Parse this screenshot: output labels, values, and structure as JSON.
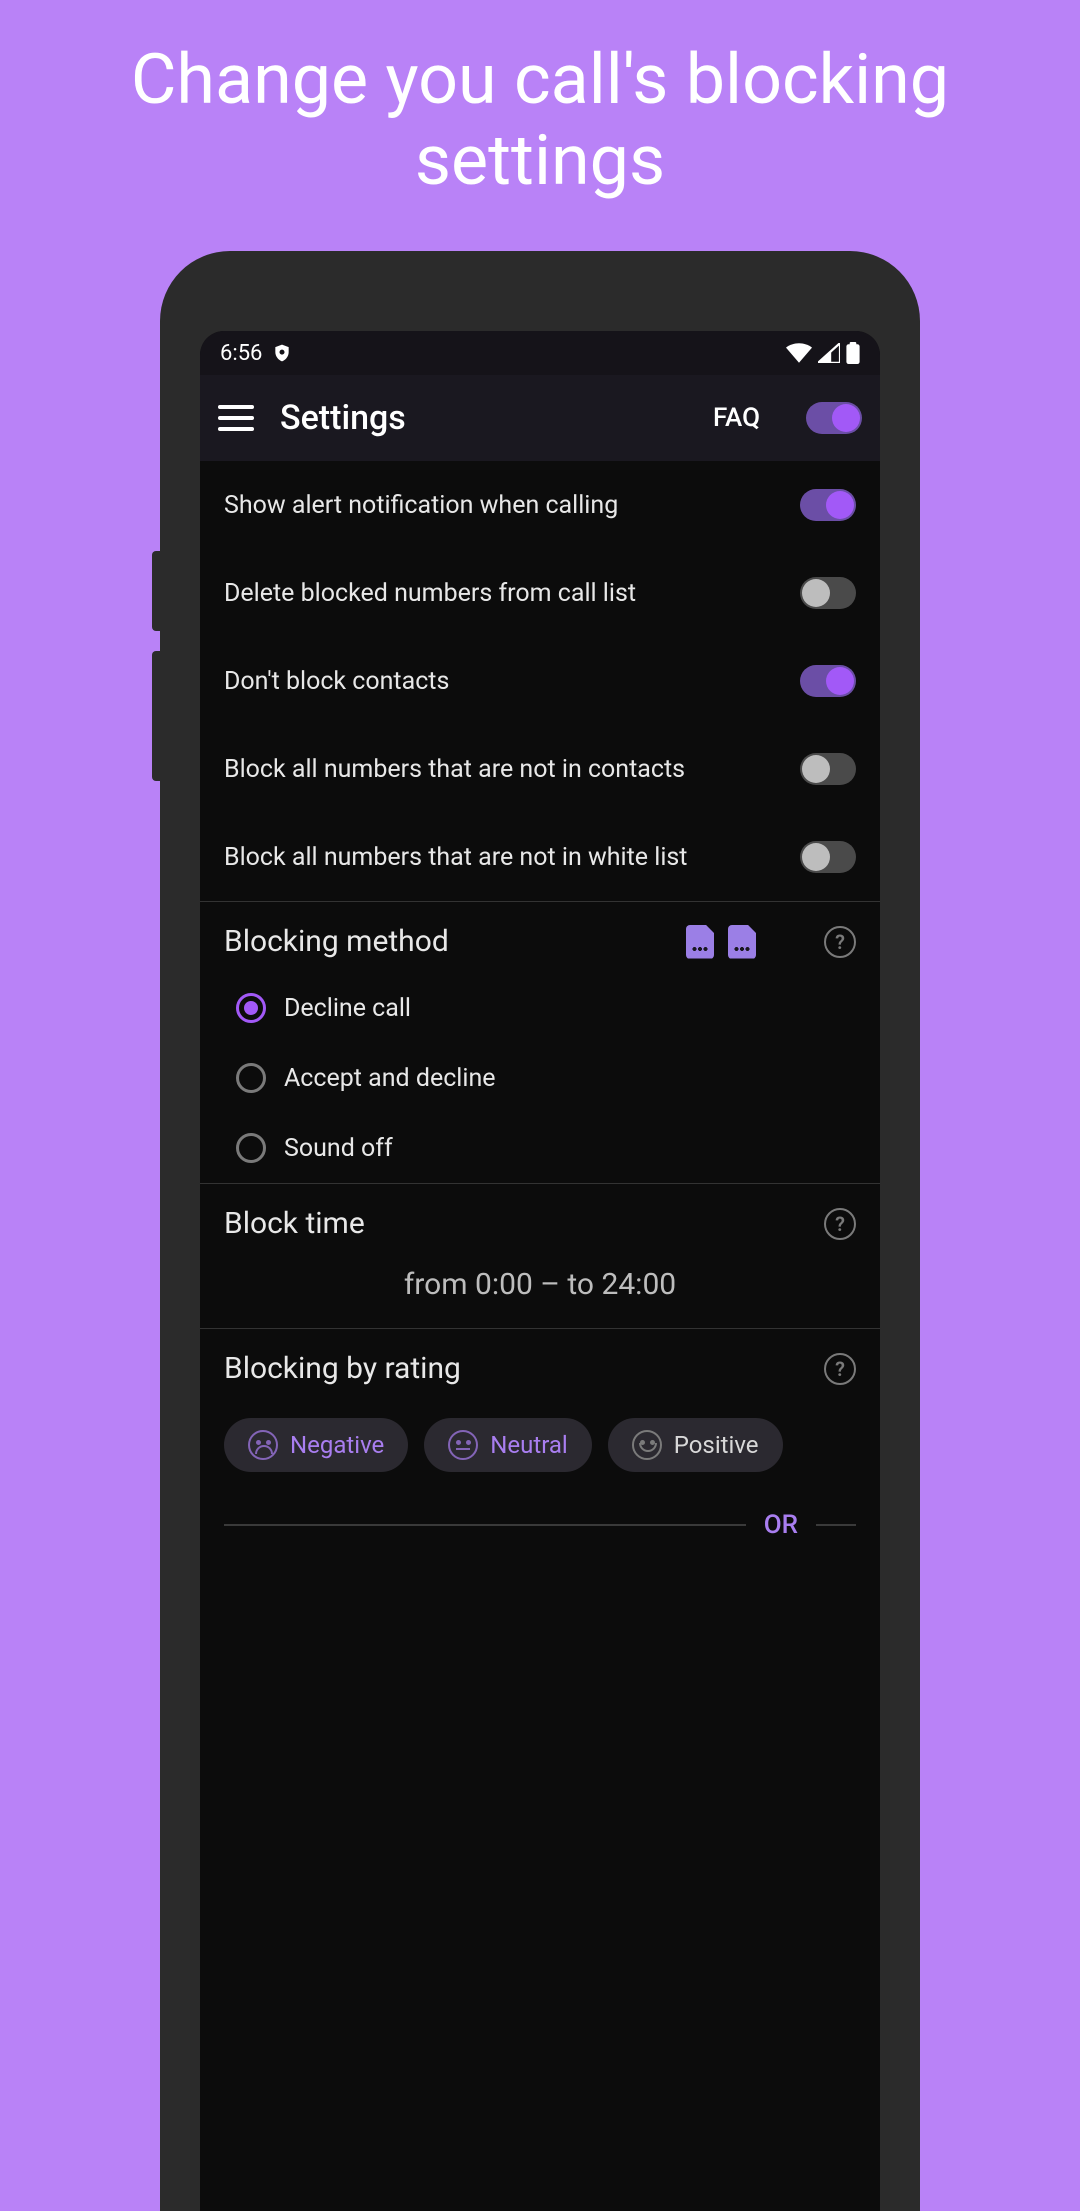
{
  "promo": {
    "title": "Change you call's blocking settings"
  },
  "status": {
    "time": "6:56"
  },
  "appbar": {
    "title": "Settings",
    "faq": "FAQ",
    "master_toggle": true
  },
  "settings": [
    {
      "label": "Show alert notification when calling",
      "on": true
    },
    {
      "label": "Delete blocked numbers from call list",
      "on": false
    },
    {
      "label": "Don't block contacts",
      "on": true
    },
    {
      "label": "Block all numbers that are not in contacts",
      "on": false
    },
    {
      "label": "Block all numbers that are not in white list",
      "on": false
    }
  ],
  "blocking_method": {
    "title": "Blocking method",
    "options": [
      {
        "label": "Decline call",
        "selected": true
      },
      {
        "label": "Accept and decline",
        "selected": false
      },
      {
        "label": "Sound off",
        "selected": false
      }
    ]
  },
  "block_time": {
    "title": "Block time",
    "value": "from 0:00 – to 24:00"
  },
  "blocking_rating": {
    "title": "Blocking by rating",
    "chips": [
      {
        "label": "Negative",
        "active": true,
        "face": "neg"
      },
      {
        "label": "Neutral",
        "active": true,
        "face": "neu"
      },
      {
        "label": "Positive",
        "active": false,
        "face": "pos"
      }
    ],
    "or": "OR"
  },
  "colors": {
    "accent": "#a259f7",
    "bg": "#b982f7"
  }
}
